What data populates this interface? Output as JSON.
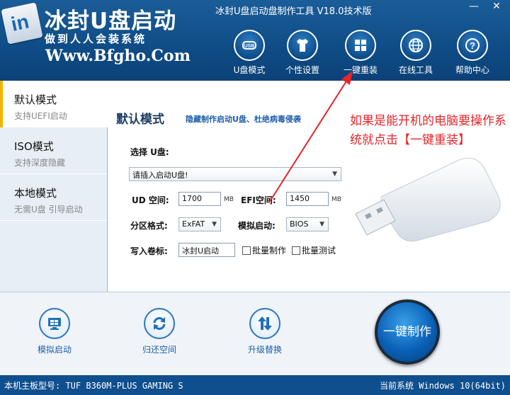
{
  "window": {
    "title": "冰封U盘启动盘制作工具 V18.0技术版",
    "min_label": "—",
    "close_label": "✕"
  },
  "brand": {
    "logo_text": "in",
    "name": "冰封U盘启动",
    "slogan": "做到人人会装系统",
    "url": "Www.Bfgho.Com"
  },
  "nav": [
    {
      "label": "U盘模式",
      "icon": "usb-icon"
    },
    {
      "label": "个性设置",
      "icon": "tshirt-icon"
    },
    {
      "label": "一键重装",
      "icon": "windows-icon"
    },
    {
      "label": "在线工具",
      "icon": "globe-icon"
    },
    {
      "label": "帮助中心",
      "icon": "help-icon"
    }
  ],
  "sidebar": {
    "items": [
      {
        "title": "默认模式",
        "subtitle": "支持UEFI启动"
      },
      {
        "title": "ISO模式",
        "subtitle": "支持深度隐藏"
      },
      {
        "title": "本地模式",
        "subtitle": "无需U盘 引导启动"
      }
    ]
  },
  "main": {
    "title": "默认模式",
    "description": "隐藏制作启动U盘、杜绝病毒侵袭",
    "select_disk_label": "选择 U盘:",
    "disk_value": "请插入启动U盘!",
    "ud_label": "UD 空间:",
    "ud_value": "1700",
    "ud_unit": "MB",
    "efi_label": "EFI空间:",
    "efi_value": "1450",
    "efi_unit": "MB",
    "partition_label": "分区格式:",
    "partition_value": "ExFAT",
    "boot_label": "模拟启动:",
    "boot_value": "BIOS",
    "volume_label": "写入卷标:",
    "volume_value": "冰封U启动",
    "batch_make": "批量制作",
    "batch_test": "批量测试"
  },
  "annotation": {
    "text": "如果是能开机的电脑要操作系统就点击【一键重装】",
    "color": "#e6242a"
  },
  "toolbar": {
    "simulate": "模拟启动",
    "restore": "归还空间",
    "upgrade": "升级替换",
    "make": "一键制作"
  },
  "status": {
    "board": "本机主板型号: TUF B360M-PLUS GAMING S",
    "system": "当前系统 Windows 10(64bit)"
  },
  "colors": {
    "header": "#0f4c86",
    "accent": "#f2b400",
    "annotation": "#e6242a",
    "status": "#0f4f8e"
  }
}
